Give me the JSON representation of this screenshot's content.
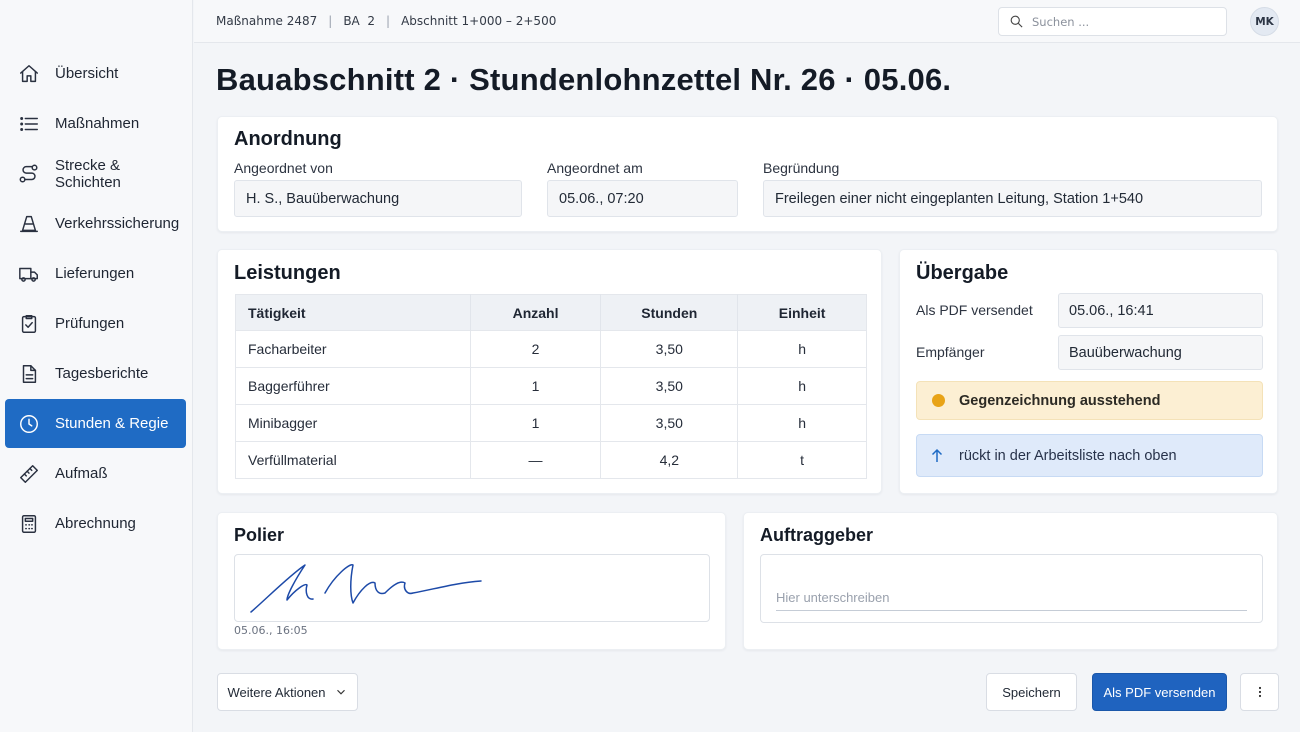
{
  "sidebar": {
    "items": [
      {
        "label": "Übersicht",
        "icon": "home-icon"
      },
      {
        "label": "Maßnahmen",
        "icon": "list-icon"
      },
      {
        "label": "Strecke & Schichten",
        "icon": "route-icon"
      },
      {
        "label": "Verkehrssicherung",
        "icon": "traffic-cone-icon"
      },
      {
        "label": "Lieferungen",
        "icon": "truck-icon"
      },
      {
        "label": "Prüfungen",
        "icon": "clipboard-check-icon"
      },
      {
        "label": "Tagesberichte",
        "icon": "document-icon"
      },
      {
        "label": "Stunden & Regie",
        "icon": "clock-icon",
        "active": true
      },
      {
        "label": "Aufmaß",
        "icon": "ruler-icon"
      },
      {
        "label": "Abrechnung",
        "icon": "calculator-icon"
      }
    ]
  },
  "topbar": {
    "crumbs": [
      "Maßnahme 2487",
      "BA  2",
      "Abschnitt 1+000 – 2+500"
    ],
    "search_placeholder": "Suchen ...",
    "avatar": "MK"
  },
  "page_title": "Bauabschnitt 2 · Stundenlohnzettel Nr. 26 · 05.06.",
  "anordnung": {
    "title": "Anordnung",
    "angeordnet_von_label": "Angeordnet von",
    "angeordnet_von_value": "H. S., Bauüberwachung",
    "angeordnet_am_label": "Angeordnet am",
    "angeordnet_am_value": "05.06., 07:20",
    "begruendung_label": "Begründung",
    "begruendung_value": "Freilegen einer nicht eingeplanten Leitung, Station 1+540"
  },
  "leistungen": {
    "title": "Leistungen",
    "headers": [
      "Tätigkeit",
      "Anzahl",
      "Stunden",
      "Einheit"
    ],
    "rows": [
      [
        "Facharbeiter",
        "2",
        "3,50",
        "h"
      ],
      [
        "Baggerführer",
        "1",
        "3,50",
        "h"
      ],
      [
        "Minibagger",
        "1",
        "3,50",
        "h"
      ],
      [
        "Verfüllmaterial",
        "—",
        "4,2",
        "t"
      ]
    ]
  },
  "uebergabe": {
    "title": "Übergabe",
    "pdf_label": "Als PDF versendet",
    "pdf_value": "05.06., 16:41",
    "empfaenger_label": "Empfänger",
    "empfaenger_value": "Bauüberwachung",
    "status_warn": "Gegenzeichnung ausstehend",
    "status_info": "rückt in der Arbeitsliste nach oben",
    "warn_color": "#e8a317",
    "info_color": "#1f6bc4"
  },
  "polier": {
    "title": "Polier",
    "timestamp": "05.06., 16:05"
  },
  "auftraggeber": {
    "title": "Auftraggeber",
    "placeholder": "Hier unterschreiben"
  },
  "actions": {
    "more": "Weitere Aktionen",
    "save": "Speichern",
    "send_pdf": "Als PDF versenden"
  }
}
